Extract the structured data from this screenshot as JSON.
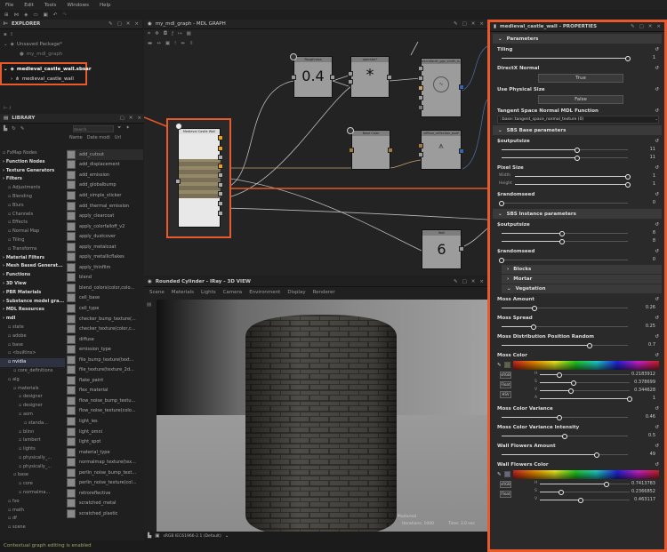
{
  "menu": [
    "File",
    "Edit",
    "Tools",
    "Windows",
    "Help"
  ],
  "explorer": {
    "title": "EXPLORER",
    "package": "Unsaved Package*",
    "graph": "my_mdl_graph",
    "sbsar": "medieval_castle_wall.sbsar",
    "material": "medieval_castle_wall"
  },
  "library": {
    "title": "LIBRARY",
    "search_placeholder": "Search",
    "columns": [
      "Name",
      "Date modi",
      "Url"
    ],
    "tree": [
      "FxMap Nodes",
      "Function Nodes",
      "Texture Generators",
      "Filters",
      "Adjustments",
      "Blending",
      "Blurs",
      "Channels",
      "Effects",
      "Normal Map",
      "Tiling",
      "Transforms",
      "Material Filters",
      "Mesh Based Generat...",
      "Functions",
      "3D View",
      "PBR Materials",
      "Substance model gra...",
      "MDL Resources",
      "mdl",
      "state",
      "adobe",
      "base",
      "<builtins>",
      "nvidia",
      "core_definitions",
      "alg",
      "materials",
      "designer",
      "designer",
      "aom",
      "standa...",
      "blinn",
      "lambert",
      "lights",
      "physically_...",
      "physically_...",
      "base",
      "core",
      "normalma...",
      "fxo",
      "math",
      "df",
      "scene"
    ],
    "items": [
      "add_cutout",
      "add_displacement",
      "add_emission",
      "add_globalbump",
      "add_simple_sticker",
      "add_thermal_emission",
      "apply_clearcoat",
      "apply_colorfalloff_v2",
      "apply_dustcover",
      "apply_metalcoat",
      "apply_metallicflakes",
      "apply_thinfilm",
      "blend",
      "blend_colors(color,colo...",
      "cell_base",
      "cell_type",
      "checker_bump_texture(...",
      "checker_texture(color,c...",
      "diffuse",
      "emission_type",
      "file_bump_texture(text...",
      "file_texture(texture_2d...",
      "flake_paint",
      "flex_material",
      "flow_noise_bump_textu...",
      "flow_noise_texture(colo...",
      "light_ies",
      "light_omni",
      "light_spot",
      "material_type",
      "normalmap_texture(tex...",
      "perlin_noise_bump_text...",
      "perlin_noise_texture(col...",
      "retroreflective",
      "scratched_metal",
      "scratched_plastic"
    ]
  },
  "graph": {
    "title": "my_mdl_graph - MDL GRAPH",
    "nodes": {
      "roughness": {
        "title": "Roughness",
        "value": "0.4"
      },
      "operator": {
        "title": "operator*",
        "value": "*"
      },
      "microfacet": {
        "title": "microfacet_ggx_smith_b..."
      },
      "basecolor": {
        "title": "Base Color"
      },
      "diffuse": {
        "title": "diffuse_reflection_bsdf"
      },
      "castle": {
        "title": "Medieval Castle Wall"
      },
      "wall": {
        "title": "Wall",
        "value": "6"
      }
    }
  },
  "view3d": {
    "title": "Rounded Cylinder - IRay - 3D VIEW",
    "menu": [
      "Scene",
      "Materials",
      "Lights",
      "Camera",
      "Environment",
      "Display",
      "Renderer"
    ],
    "overlay1": "Photoreal",
    "overlay2": "Iterations: 1000",
    "overlay3": "Time: 3.0 sec",
    "colorspace": "sRGB IEC61966-2.1 (Default)"
  },
  "properties": {
    "title": "medieval_castle_wall - PROPERTIES",
    "rows": [
      {
        "t": "sec",
        "label": "Parameters"
      },
      {
        "t": "slider",
        "label": "Tiling",
        "sliders": [
          {
            "f": 1,
            "v": "1"
          }
        ]
      },
      {
        "t": "button",
        "label": "DirectX Normal",
        "value": "True"
      },
      {
        "t": "button",
        "label": "Use Physical Size",
        "value": "False"
      },
      {
        "t": "select",
        "label": "Tangent Space Normal MDL Function",
        "value": "::base::tangent_space_normal_texture (0)"
      },
      {
        "t": "sec",
        "label": "SBS Base parameters"
      },
      {
        "t": "slider",
        "label": "$outputsize",
        "sliders": [
          {
            "f": 0.6,
            "v": "11"
          },
          {
            "f": 0.6,
            "v": "11"
          }
        ]
      },
      {
        "t": "slider",
        "label": "Pixel Size",
        "sliders": [
          {
            "n": "Width",
            "f": 1,
            "v": "1"
          },
          {
            "n": "Height",
            "f": 1,
            "v": "1"
          }
        ]
      },
      {
        "t": "slider",
        "label": "$randomseed",
        "sliders": [
          {
            "f": 0,
            "v": "0"
          }
        ]
      },
      {
        "t": "sec",
        "label": "SBS Instance parameters"
      },
      {
        "t": "slider",
        "label": "$outputsize",
        "sliders": [
          {
            "f": 0.48,
            "v": "8"
          },
          {
            "f": 0.48,
            "v": "8"
          }
        ]
      },
      {
        "t": "slider",
        "label": "$randomseed",
        "sliders": [
          {
            "f": 0,
            "v": "0"
          }
        ]
      },
      {
        "t": "sub",
        "label": "Blocks",
        "open": false
      },
      {
        "t": "sub",
        "label": "Mortar",
        "open": false
      },
      {
        "t": "sub",
        "label": "Vegetation",
        "open": true
      },
      {
        "t": "slider",
        "label": "Moss Amount",
        "sliders": [
          {
            "f": 0.26,
            "v": "0.26"
          }
        ]
      },
      {
        "t": "slider",
        "label": "Moss Spread",
        "sliders": [
          {
            "f": 0.25,
            "v": "0.25"
          }
        ]
      },
      {
        "t": "slider",
        "label": "Moss Distribution Position Random",
        "sliders": [
          {
            "f": 0.7,
            "v": "0.7"
          }
        ]
      },
      {
        "t": "color",
        "label": "Moss Color",
        "swatch": "#5f6440",
        "buttons": [
          "sRGB",
          "Float",
          "HSV"
        ],
        "sliders": [
          {
            "n": "H",
            "f": 0.218,
            "v": "0.2183912"
          },
          {
            "n": "S",
            "f": 0.379,
            "v": "0.378699"
          },
          {
            "n": "V",
            "f": 0.345,
            "v": "0.344628"
          },
          {
            "n": "A",
            "f": 1,
            "v": "1"
          }
        ]
      },
      {
        "t": "slider",
        "label": "Moss Color Variance",
        "sliders": [
          {
            "f": 0.46,
            "v": "0.46"
          }
        ]
      },
      {
        "t": "slider",
        "label": "Moss Color Variance Intensity",
        "sliders": [
          {
            "f": 0.5,
            "v": "0.5"
          }
        ]
      },
      {
        "t": "slider",
        "label": "Wall Flowers Amount",
        "sliders": [
          {
            "f": 0.75,
            "v": "49"
          }
        ]
      },
      {
        "t": "color",
        "label": "Wall Flowers Color",
        "swatch": "#6e6380",
        "buttons": [
          "sRGB",
          "Float"
        ],
        "sliders": [
          {
            "n": "H",
            "f": 0.741,
            "v": "0.7413783"
          },
          {
            "n": "S",
            "f": 0.237,
            "v": "0.2366852"
          },
          {
            "n": "V",
            "f": 0.46,
            "v": "0.463117"
          }
        ]
      }
    ]
  },
  "status": "Contextual graph editing is enabled",
  "colors": {
    "accent": "#e8592b",
    "orange_port": "#e8a020"
  }
}
